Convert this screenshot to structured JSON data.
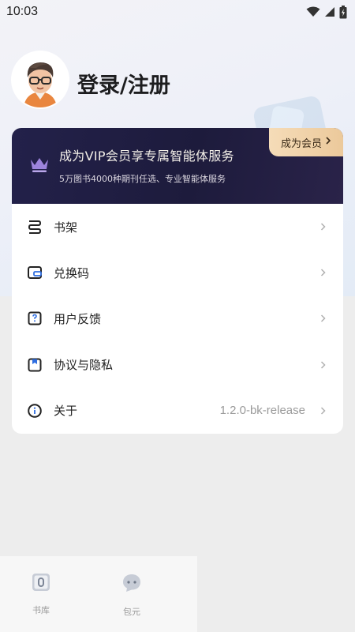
{
  "status_bar": {
    "time": "10:03",
    "icons": [
      "wifi-icon",
      "signal-icon",
      "battery-icon"
    ]
  },
  "header": {
    "login_label": "登录/注册",
    "avatar_icon": "avatar-icon"
  },
  "vip": {
    "title": "成为VIP会员享专属智能体服务",
    "subtitle": "5万图书4000种期刊任选、专业智能体服务",
    "button_label": "成为会员",
    "colors": {
      "banner": "#1d1b3c",
      "button": "#f0d1a8",
      "crown": "#9a7fd6"
    }
  },
  "menu": {
    "items": [
      {
        "label": "书架",
        "icon": "bookshelf-icon",
        "value": ""
      },
      {
        "label": "兑换码",
        "icon": "wallet-icon",
        "value": ""
      },
      {
        "label": "用户反馈",
        "icon": "feedback-icon",
        "value": ""
      },
      {
        "label": "协议与隐私",
        "icon": "bookmark-icon",
        "value": ""
      },
      {
        "label": "关于",
        "icon": "info-icon",
        "value": "1.2.0-bk-release"
      }
    ]
  },
  "bottom_nav": {
    "items": [
      {
        "label": "书库",
        "icon": "library-icon"
      },
      {
        "label": "包元",
        "icon": "chat-icon"
      }
    ]
  }
}
